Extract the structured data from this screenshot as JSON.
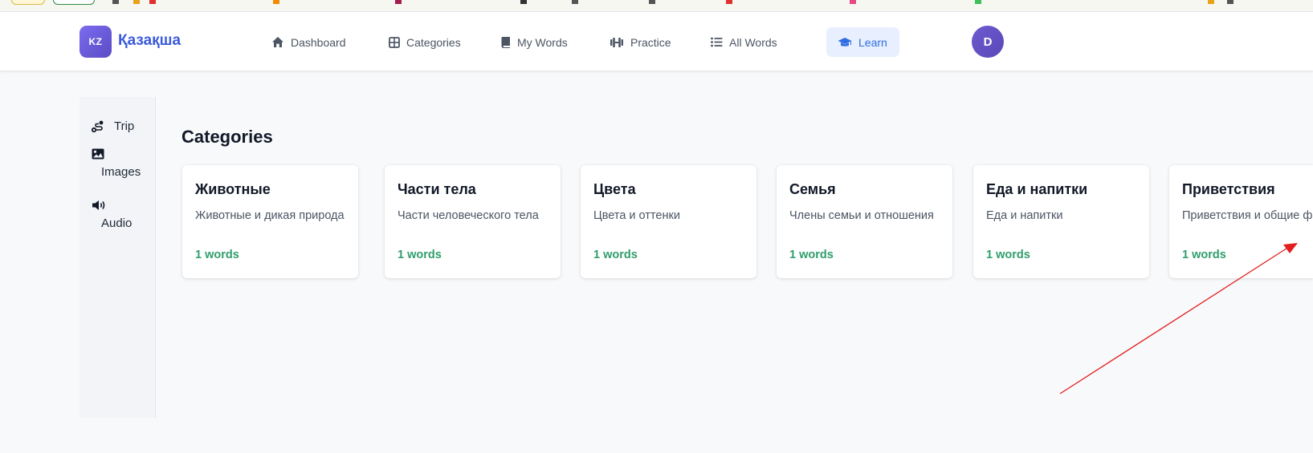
{
  "app": {
    "logo_text": "KZ",
    "brand": "Қазақша"
  },
  "nav": {
    "items": [
      {
        "label": "Dashboard",
        "icon": "home-icon"
      },
      {
        "label": "Categories",
        "icon": "grid-icon"
      },
      {
        "label": "My Words",
        "icon": "book-icon"
      },
      {
        "label": "Practice",
        "icon": "dumbbell-icon"
      },
      {
        "label": "All Words",
        "icon": "list-icon"
      },
      {
        "label": "Learn",
        "icon": "graduation-cap-icon",
        "active": true
      }
    ],
    "avatar_initial": "D"
  },
  "sidebar": {
    "items": [
      {
        "label": "Trip",
        "icon": "route-icon"
      },
      {
        "label": "Images",
        "icon": "image-icon"
      },
      {
        "label": "Audio",
        "icon": "speaker-icon"
      }
    ]
  },
  "main": {
    "title": "Categories",
    "cards": [
      {
        "title": "Животные",
        "desc": "Животные и дикая природа",
        "count": "1 words"
      },
      {
        "title": "Части тела",
        "desc": "Части человеческого тела",
        "count": "1 words"
      },
      {
        "title": "Цвета",
        "desc": "Цвета и оттенки",
        "count": "1 words"
      },
      {
        "title": "Семья",
        "desc": "Члены семьи и отношения",
        "count": "1 words"
      },
      {
        "title": "Еда и напитки",
        "desc": "Еда и напитки",
        "count": "1 words"
      },
      {
        "title": "Приветствия",
        "desc": "Приветствия и общие ф",
        "count": "1 words"
      }
    ]
  },
  "colors": {
    "accent": "#2f6ee0",
    "brand": "#3b5bdb",
    "count_green": "#2f9e6b",
    "annotation_arrow": "#e11d1d"
  }
}
